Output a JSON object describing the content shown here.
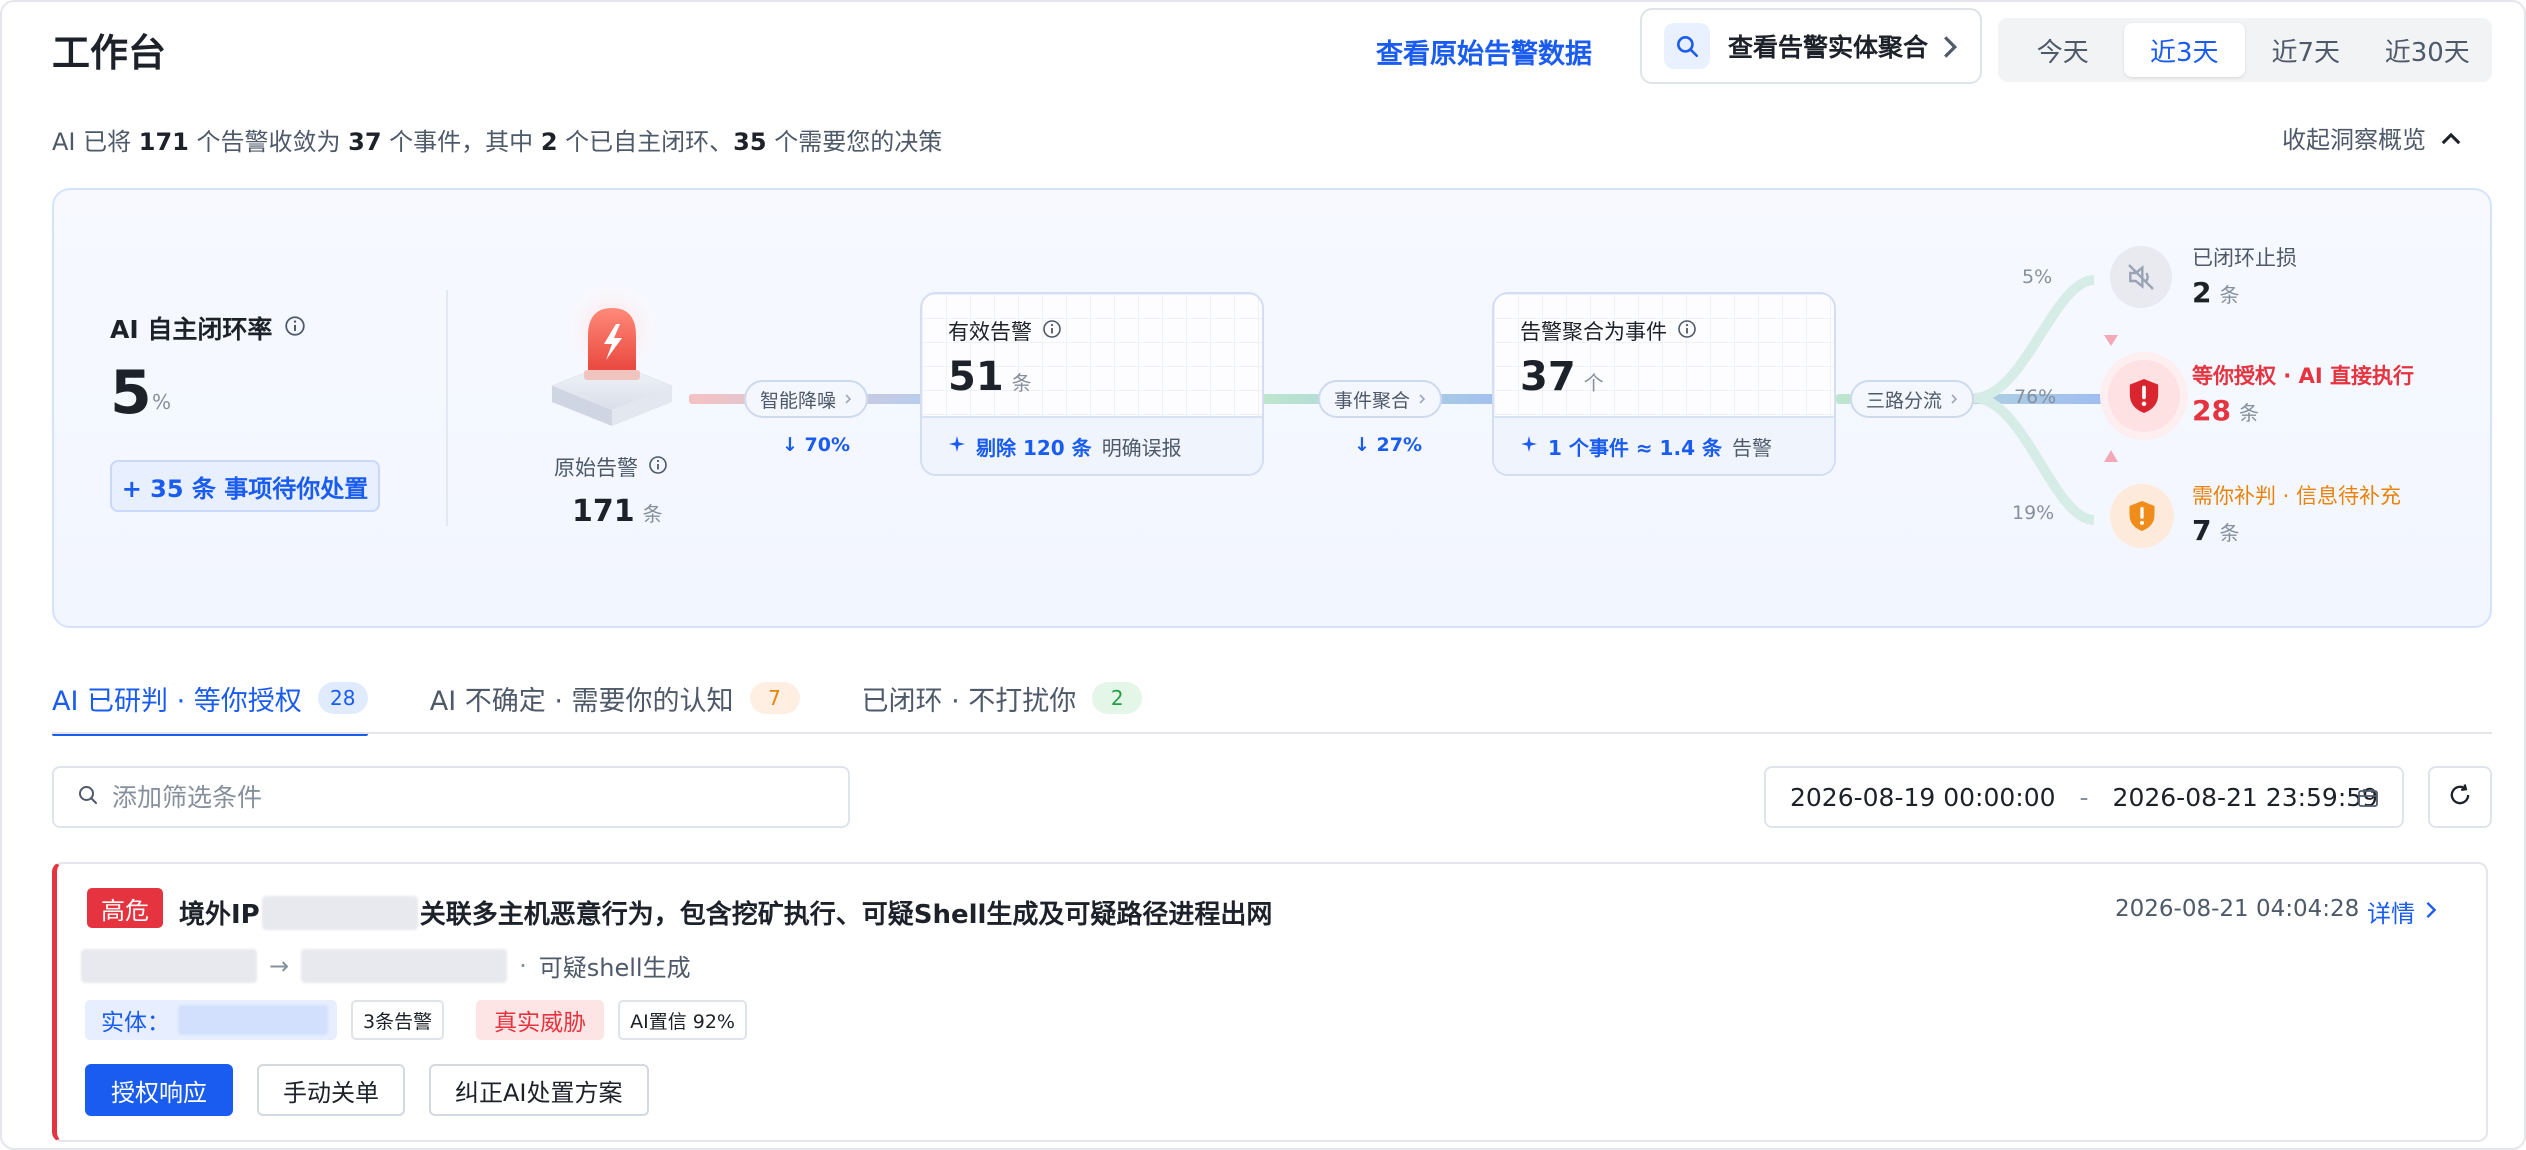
{
  "header": {
    "title": "工作台",
    "raw_link": "查看原始告警数据",
    "entity_button": "查看告警实体聚合",
    "ranges": [
      "今天",
      "近3天",
      "近7天",
      "近30天"
    ],
    "active_range": 1
  },
  "summary": {
    "p1": "AI 已将 ",
    "n1": "171",
    "p2": " 个告警收敛为 ",
    "n2": "37",
    "p3": " 个事件，其中 ",
    "n3": "2",
    "p4": " 个已自主闭环、",
    "n4": "35",
    "p5": " 个需要您的决策",
    "collapse_label": "收起洞察概览"
  },
  "overview": {
    "rate_title": "AI 自主闭环率",
    "rate_value": "5",
    "rate_unit": "%",
    "pending_button": "+ 35 条 事项待你处置",
    "raw": {
      "label": "原始告警",
      "value": "171",
      "unit": "条"
    },
    "step1": {
      "label": "智能降噪",
      "pct": "↓ 70%"
    },
    "valid": {
      "title": "有效告警",
      "value": "51",
      "unit": "条",
      "foot_bold": "剔除 120 条",
      "foot_rest": "明确误报"
    },
    "step2": {
      "label": "事件聚合",
      "pct": "↓ 27%"
    },
    "events": {
      "title": "告警聚合为事件",
      "value": "37",
      "unit": "个",
      "foot_bold": "1 个事件 ≈ 1.4 条",
      "foot_rest": "告警"
    },
    "step3": {
      "label": "三路分流"
    },
    "outcomes": [
      {
        "pct": "5%",
        "title": "已闭环止损",
        "value": "2",
        "unit": "条"
      },
      {
        "pct": "76%",
        "title": "等你授权 · AI 直接执行",
        "value": "28",
        "unit": "条"
      },
      {
        "pct": "19%",
        "title": "需你补判 · 信息待补充",
        "value": "7",
        "unit": "条"
      }
    ]
  },
  "tabs": [
    {
      "label": "AI 已研判 · 等你授权",
      "count": "28"
    },
    {
      "label": "AI 不确定 · 需要你的认知",
      "count": "7"
    },
    {
      "label": "已闭环 · 不打扰你",
      "count": "2"
    }
  ],
  "filter": {
    "placeholder": "添加筛选条件",
    "date_start": "2026-08-19 00:00:00",
    "date_sep": "-",
    "date_end": "2026-08-21 23:59:59"
  },
  "alert": {
    "severity": "高危",
    "title_prefix": "境外IP",
    "title_suffix": "关联多主机恶意行为，包含挖矿执行、可疑Shell生成及可疑路径进程出网",
    "time": "2026-08-21 04:04:28",
    "detail": "详情",
    "path_arrow": "→",
    "path_dot": "·",
    "path_label": "可疑shell生成",
    "entity_label": "实体：",
    "alert_count": "3条告警",
    "threat": "真实威胁",
    "confidence": "AI置信 92%",
    "actions": [
      "授权响应",
      "手动关单",
      "纠正AI处置方案"
    ]
  },
  "colors": {
    "accent": "#1a5cf0",
    "danger": "#e5343f",
    "warning": "#e8830c"
  }
}
